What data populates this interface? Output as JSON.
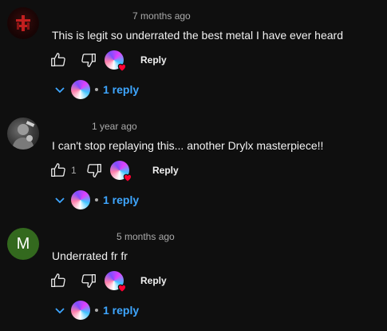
{
  "colors": {
    "background": "#0f0f0f",
    "link_blue": "#3ea6ff",
    "heart_red": "#ff0033",
    "letter_avatar_green": "#33691e"
  },
  "comments": [
    {
      "avatar": {
        "type": "image",
        "description_icon": "red-glyph-avatar"
      },
      "timestamp": "7 months ago",
      "text": "This is legit so underrated the best metal I have ever heard",
      "like_count": "",
      "reply_label": "Reply",
      "replies_label": "1 reply"
    },
    {
      "avatar": {
        "type": "image",
        "description_icon": "grey-figure-avatar"
      },
      "timestamp": "1 year ago",
      "text": "I can't stop replaying this... another Drylx masterpiece!!",
      "like_count": "1",
      "reply_label": "Reply",
      "replies_label": "1 reply"
    },
    {
      "avatar": {
        "type": "letter",
        "letter": "M"
      },
      "timestamp": "5 months ago",
      "text": "Underrated fr fr",
      "like_count": "",
      "reply_label": "Reply",
      "replies_label": "1 reply"
    }
  ]
}
